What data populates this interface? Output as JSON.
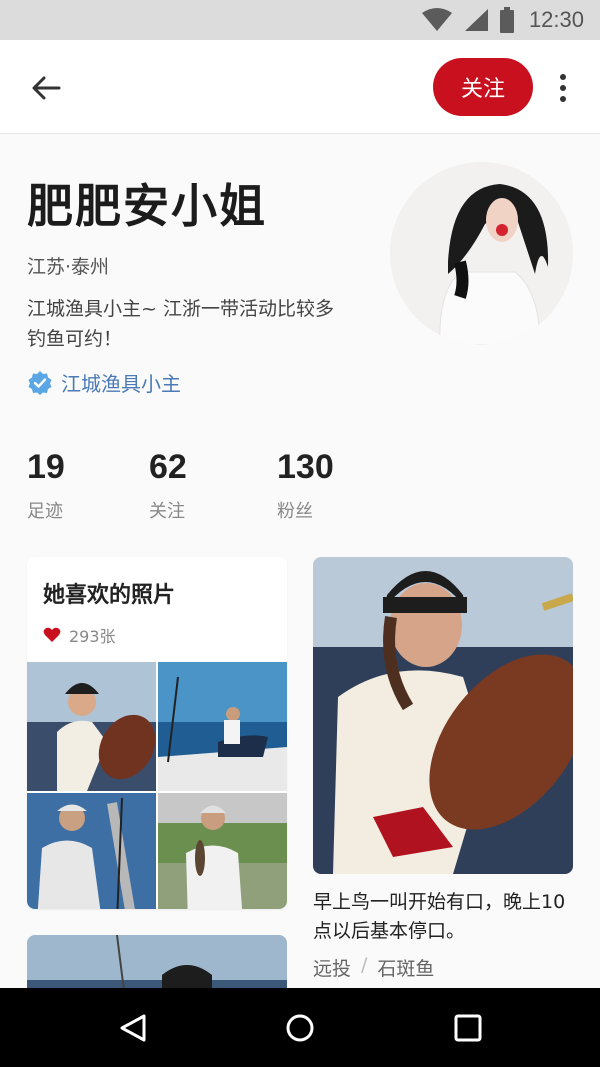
{
  "status_bar": {
    "time": "12:30",
    "icons": [
      "wifi-icon",
      "signal-icon",
      "battery-icon"
    ]
  },
  "app_bar": {
    "back_icon": "arrow-left-icon",
    "follow_label": "关注",
    "more_icon": "more-vertical-icon",
    "accent_color": "#c8101e"
  },
  "profile": {
    "name": "肥肥安小姐",
    "location": "江苏·泰州",
    "bio": "江城渔具小主~ 江浙一带活动比较多钓鱼可约！",
    "verified_icon": "verified-badge-icon",
    "verified_label": "江城渔具小主",
    "stats": [
      {
        "value": "19",
        "label": "足迹"
      },
      {
        "value": "62",
        "label": "关注"
      },
      {
        "value": "130",
        "label": "粉丝"
      }
    ]
  },
  "liked_photos": {
    "title": "她喜欢的照片",
    "heart_icon": "heart-icon",
    "count": "293张"
  },
  "post": {
    "text": "早上鸟一叫开始有口，晚上10点以后基本停口。",
    "tags": [
      "远投",
      "石斑鱼"
    ],
    "tag_separator": "/"
  },
  "nav_bar": {
    "icons": [
      "back-triangle-icon",
      "home-circle-icon",
      "recents-square-icon"
    ]
  }
}
